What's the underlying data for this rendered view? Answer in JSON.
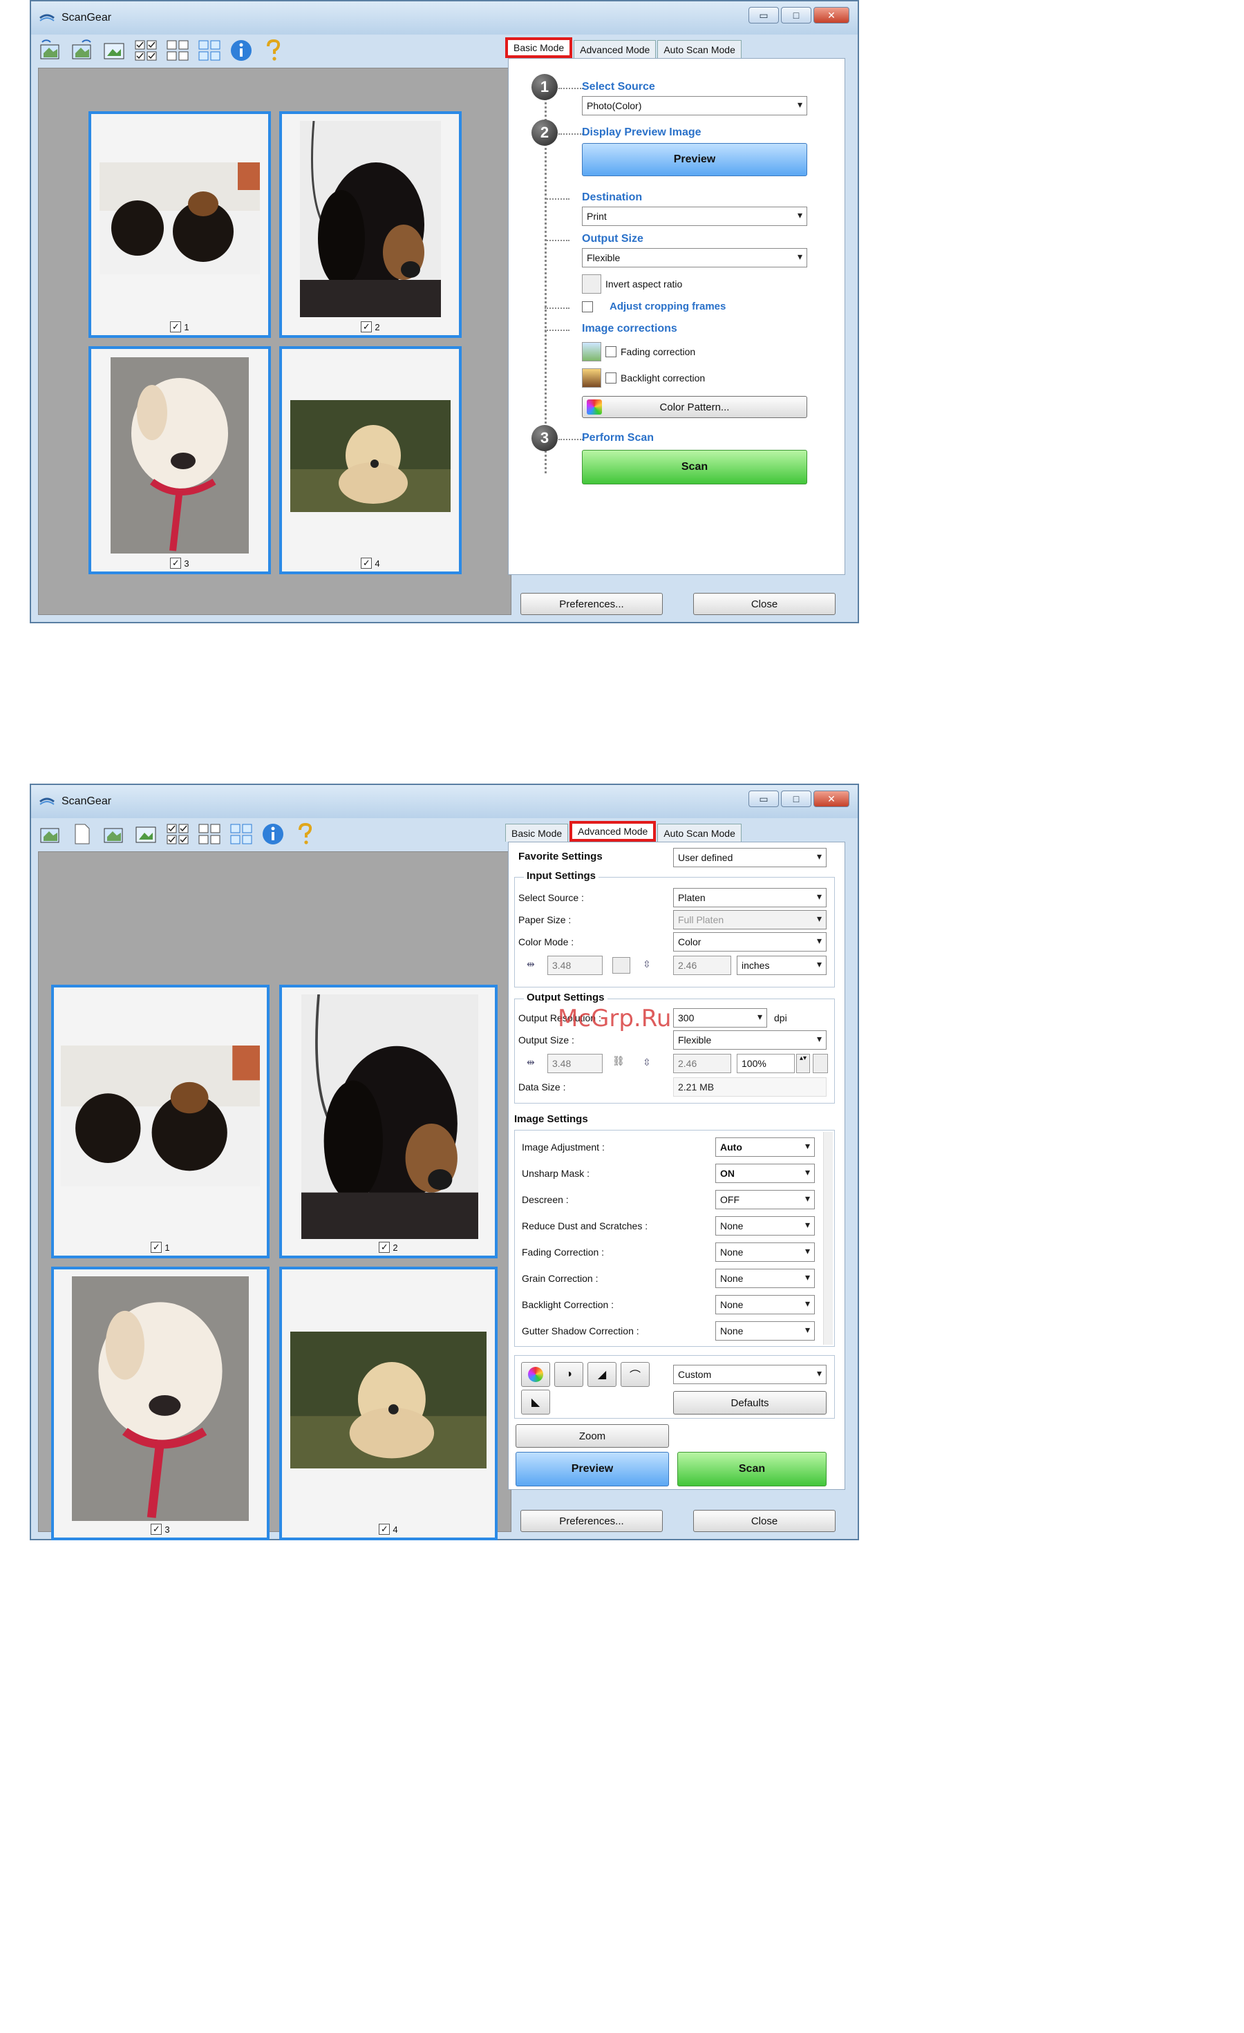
{
  "app": {
    "title": "ScanGear"
  },
  "window_controls": {
    "minimize": "▭",
    "maximize": "□",
    "close": "✕"
  },
  "tabs": [
    "Basic Mode",
    "Advanced Mode",
    "Auto Scan Mode"
  ],
  "toolbar_icons": [
    "rotate-left-icon",
    "rotate-right-icon",
    "auto-crop-icon",
    "check-all-icon",
    "uncheck-all-icon",
    "view-toggle-icon",
    "info-icon",
    "help-icon"
  ],
  "thumbnails": [
    {
      "label": "1",
      "checked": "✓"
    },
    {
      "label": "2",
      "checked": "✓"
    },
    {
      "label": "3",
      "checked": "✓"
    },
    {
      "label": "4",
      "checked": "✓"
    }
  ],
  "basic": {
    "step1": "1",
    "step2": "2",
    "step3": "3",
    "select_source_label": "Select Source",
    "select_source_value": "Photo(Color)",
    "display_preview_label": "Display Preview Image",
    "preview_button": "Preview",
    "destination_label": "Destination",
    "destination_value": "Print",
    "output_size_label": "Output Size",
    "output_size_value": "Flexible",
    "invert_aspect": "Invert aspect ratio",
    "adjust_cropping": "Adjust cropping frames",
    "image_corrections_label": "Image corrections",
    "fading_correction": "Fading correction",
    "backlight_correction": "Backlight correction",
    "color_pattern_button": "Color Pattern...",
    "perform_scan_label": "Perform Scan",
    "scan_button": "Scan"
  },
  "advanced": {
    "favorite_settings_label": "Favorite Settings",
    "favorite_settings_value": "User defined",
    "input_settings_title": "Input Settings",
    "select_source_label": "Select Source :",
    "select_source_value": "Platen",
    "paper_size_label": "Paper Size :",
    "paper_size_value": "Full Platen",
    "color_mode_label": "Color Mode :",
    "color_mode_value": "Color",
    "input_width": "3.48",
    "input_height": "2.46",
    "unit_value": "inches",
    "output_settings_title": "Output Settings",
    "output_resolution_label": "Output Resolution :",
    "output_resolution_value": "300",
    "dpi": "dpi",
    "output_size_label": "Output Size :",
    "output_size_value": "Flexible",
    "output_width": "3.48",
    "output_height": "2.46",
    "scale": "100%",
    "data_size_label": "Data Size :",
    "data_size_value": "2.21 MB",
    "image_settings_title": "Image Settings",
    "image_settings": [
      {
        "label": "Image Adjustment :",
        "value": "Auto"
      },
      {
        "label": "Unsharp Mask :",
        "value": "ON"
      },
      {
        "label": "Descreen :",
        "value": "OFF"
      },
      {
        "label": "Reduce Dust and Scratches :",
        "value": "None"
      },
      {
        "label": "Fading Correction :",
        "value": "None"
      },
      {
        "label": "Grain Correction :",
        "value": "None"
      },
      {
        "label": "Backlight Correction :",
        "value": "None"
      },
      {
        "label": "Gutter Shadow Correction :",
        "value": "None"
      }
    ],
    "tone_preset_value": "Custom",
    "defaults_button": "Defaults",
    "zoom_button": "Zoom",
    "preview_button": "Preview",
    "scan_button": "Scan"
  },
  "footer": {
    "preferences_button": "Preferences...",
    "close_button": "Close"
  },
  "watermark": "McGrp.Ru"
}
